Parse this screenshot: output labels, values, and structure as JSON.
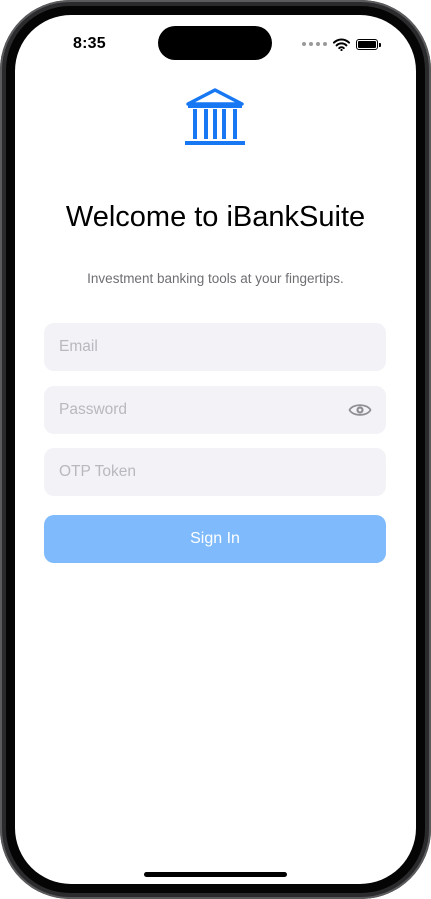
{
  "status_bar": {
    "time": "8:35"
  },
  "header": {
    "logo_icon": "bank-icon",
    "title": "Welcome to iBankSuite",
    "subtitle": "Investment banking tools at your fingertips."
  },
  "form": {
    "email": {
      "value": "",
      "placeholder": "Email"
    },
    "password": {
      "value": "",
      "placeholder": "Password",
      "toggle_icon": "eye-icon"
    },
    "otp": {
      "value": "",
      "placeholder": "OTP Token"
    },
    "sign_in_label": "Sign In"
  },
  "colors": {
    "accent": "#1877f2",
    "button_disabled": "#7fbafc",
    "field_background": "#f2f2f7"
  }
}
